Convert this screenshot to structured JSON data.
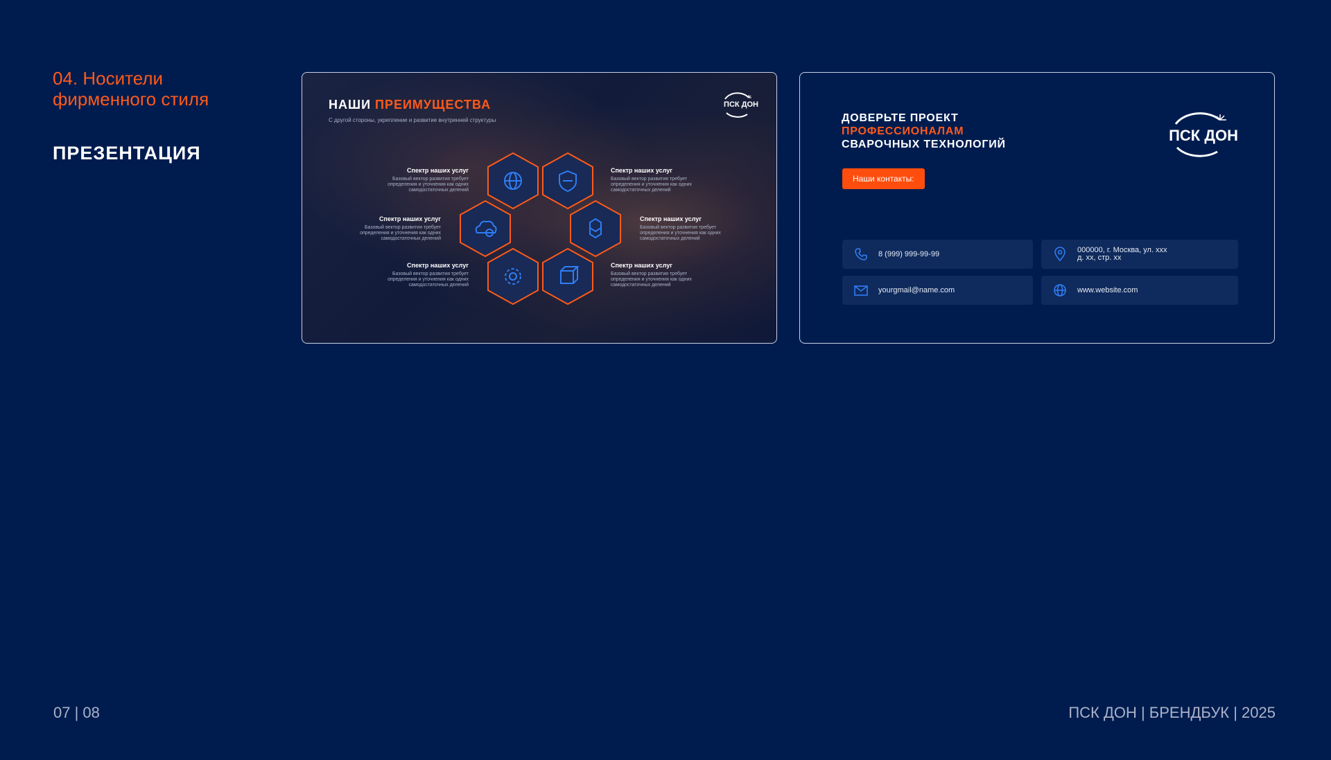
{
  "section": {
    "title": "04. Носители фирменного стиля",
    "subtitle": "ПРЕЗЕНТАЦИЯ"
  },
  "footer": {
    "page": "07 | 08",
    "brand": "ПСК ДОН | БРЕНДБУК | 2025"
  },
  "slide1": {
    "title_white": "НАШИ",
    "title_accent": "ПРЕИМУЩЕСТВА",
    "subtitle": "С другой стороны, укрепление и развитие внутренней структуры",
    "logo_text": "ПСК ДОН",
    "advantages": [
      {
        "title": "Спектр наших услуг",
        "desc": "Базовый вектор развития требует определения и уточнения как одних самодостаточных делений"
      },
      {
        "title": "Спектр наших услуг",
        "desc": "Базовый вектор развития требует определения и уточнения как одних самодостаточных делений"
      },
      {
        "title": "Спектр наших услуг",
        "desc": "Базовый вектор развития требует определения и уточнения как одних самодостаточных делений"
      },
      {
        "title": "Спектр наших услуг",
        "desc": "Базовый вектор развития требует определения и уточнения как одних самодостаточных делений"
      },
      {
        "title": "Спектр наших услуг",
        "desc": "Базовый вектор развития требует определения и уточнения как одних самодостаточных делений"
      },
      {
        "title": "Спектр наших услуг",
        "desc": "Базовый вектор развития требует определения и уточнения как одних самодостаточных делений"
      }
    ],
    "icons": [
      "globe-icon",
      "shield-icon",
      "cloud-icon",
      "cubes-icon",
      "gear-icon",
      "box-icon"
    ]
  },
  "slide2": {
    "headline_line1": "ДОВЕРЬТЕ ПРОЕКТ",
    "headline_line2": "ПРОФЕССИОНАЛАМ",
    "headline_line3": "СВАРОЧНЫХ ТЕХНОЛОГИЙ",
    "button_label": "Наши контакты:",
    "logo_text": "ПСК ДОН",
    "contacts": {
      "phone": "8 (999) 999-99-99",
      "address_line1": "000000, г. Москва, ул. xxx",
      "address_line2": "д. xx, стр. xx",
      "email": "yourgmail@name.com",
      "website": "www.website.com"
    }
  },
  "colors": {
    "background": "#001c4f",
    "accent": "#ff5a1a",
    "icon_blue": "#2f7df6",
    "card": "#0f2a5c"
  }
}
